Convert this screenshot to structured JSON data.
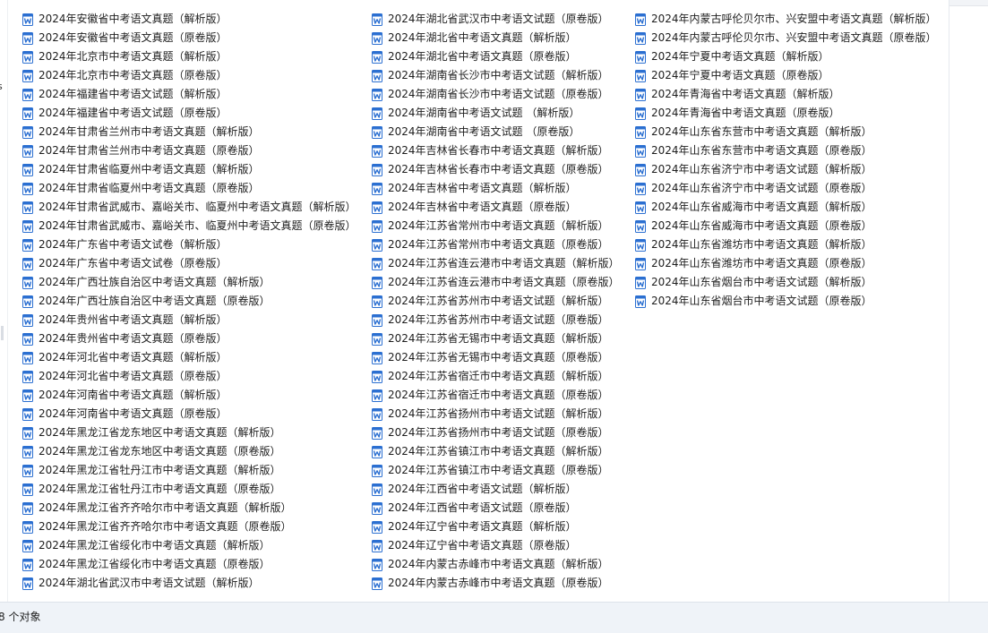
{
  "colors": {
    "word_icon_blue": "#2b6fd1",
    "status_bar_bg": "#eff3f8"
  },
  "icon": "word-document-icon",
  "columns": [
    [
      "2024年安徽省中考语文真题（解析版）",
      "2024年安徽省中考语文真题（原卷版）",
      "2024年北京市中考语文真题（解析版）",
      "2024年北京市中考语文真题（原卷版）",
      "2024年福建省中考语文试题（解析版）",
      "2024年福建省中考语文试题（原卷版）",
      "2024年甘肃省兰州市中考语文真题（解析版）",
      "2024年甘肃省兰州市中考语文真题（原卷版）",
      "2024年甘肃省临夏州中考语文真题（解析版）",
      "2024年甘肃省临夏州中考语文真题（原卷版）",
      "2024年甘肃省武威市、嘉峪关市、临夏州中考语文真题（解析版）",
      "2024年甘肃省武威市、嘉峪关市、临夏州中考语文真题（原卷版）",
      "2024年广东省中考语文试卷（解析版）",
      "2024年广东省中考语文试卷（原卷版）",
      "2024年广西壮族自治区中考语文真题（解析版）",
      "2024年广西壮族自治区中考语文真题（原卷版）",
      "2024年贵州省中考语文真题（解析版）",
      "2024年贵州省中考语文真题（原卷版）",
      "2024年河北省中考语文真题（解析版）",
      "2024年河北省中考语文真题（原卷版）",
      "2024年河南省中考语文真题（解析版）",
      "2024年河南省中考语文真题（原卷版）",
      "2024年黑龙江省龙东地区中考语文真题（解析版）",
      "2024年黑龙江省龙东地区中考语文真题（原卷版）",
      "2024年黑龙江省牡丹江市中考语文真题（解析版）",
      "2024年黑龙江省牡丹江市中考语文真题（原卷版）",
      "2024年黑龙江省齐齐哈尔市中考语文真题（解析版）",
      "2024年黑龙江省齐齐哈尔市中考语文真题（原卷版）",
      "2024年黑龙江省绥化市中考语文真题（解析版）",
      "2024年黑龙江省绥化市中考语文真题（原卷版）",
      "2024年湖北省武汉市中考语文试题（解析版）"
    ],
    [
      "2024年湖北省武汉市中考语文试题（原卷版）",
      "2024年湖北省中考语文真题（解析版）",
      "2024年湖北省中考语文真题（原卷版）",
      "2024年湖南省长沙市中考语文试题（解析版）",
      "2024年湖南省长沙市中考语文试题（原卷版）",
      "2024年湖南省中考语文试题 （解析版）",
      "2024年湖南省中考语文试题 （原卷版）",
      "2024年吉林省长春市中考语文真题（解析版）",
      "2024年吉林省长春市中考语文真题（原卷版）",
      "2024年吉林省中考语文真题（解析版）",
      "2024年吉林省中考语文真题（原卷版）",
      "2024年江苏省常州市中考语文真题（解析版）",
      "2024年江苏省常州市中考语文真题（原卷版）",
      "2024年江苏省连云港市中考语文真题（解析版）",
      "2024年江苏省连云港市中考语文真题（原卷版）",
      "2024年江苏省苏州市中考语文试题（解析版）",
      "2024年江苏省苏州市中考语文试题（原卷版）",
      "2024年江苏省无锡市中考语文真题（解析版）",
      "2024年江苏省无锡市中考语文真题（原卷版）",
      "2024年江苏省宿迁市中考语文真题（解析版）",
      "2024年江苏省宿迁市中考语文真题（原卷版）",
      "2024年江苏省扬州市中考语文试题（解析版）",
      "2024年江苏省扬州市中考语文试题（原卷版）",
      "2024年江苏省镇江市中考语文真题（解析版）",
      "2024年江苏省镇江市中考语文真题（原卷版）",
      "2024年江西省中考语文试题（解析版）",
      "2024年江西省中考语文试题（原卷版）",
      "2024年辽宁省中考语文真题（解析版）",
      "2024年辽宁省中考语文真题（原卷版）",
      "2024年内蒙古赤峰市中考语文真题（解析版）",
      "2024年内蒙古赤峰市中考语文真题（原卷版）"
    ],
    [
      "2024年内蒙古呼伦贝尔市、兴安盟中考语文真题（解析版）",
      "2024年内蒙古呼伦贝尔市、兴安盟中考语文真题（原卷版）",
      "2024年宁夏中考语文真题（解析版）",
      "2024年宁夏中考语文真题（原卷版）",
      "2024年青海省中考语文真题（解析版）",
      "2024年青海省中考语文真题（原卷版）",
      "2024年山东省东营市中考语文真题（解析版）",
      "2024年山东省东营市中考语文真题（原卷版）",
      "2024年山东省济宁市中考语文试题（解析版）",
      "2024年山东省济宁市中考语文试题（原卷版）",
      "2024年山东省威海市中考语文真题（解析版）",
      "2024年山东省威海市中考语文真题（原卷版）",
      "2024年山东省潍坊市中考语文真题（解析版）",
      "2024年山东省潍坊市中考语文真题（原卷版）",
      "2024年山东省烟台市中考语文试题（解析版）",
      "2024年山东省烟台市中考语文试题（原卷版）"
    ]
  ],
  "status_bar": {
    "item_count": "8 个对象"
  },
  "left_strip": {
    "glyph": "s"
  }
}
